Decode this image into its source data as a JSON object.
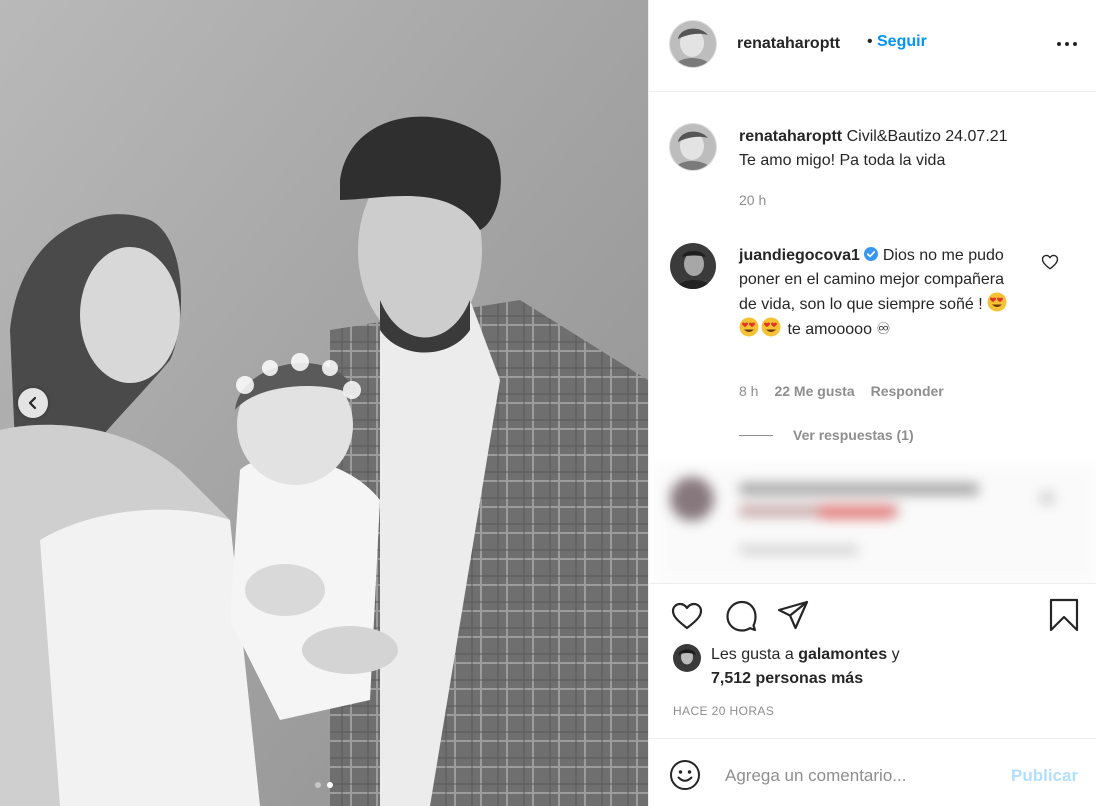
{
  "post": {
    "author": "renataharoptt",
    "separator": "•",
    "follow_label": "Seguir",
    "carousel_slides": 2,
    "carousel_active": 2
  },
  "caption": {
    "username": "renataharoptt",
    "text_line1": "Civil&Bautizo 24.07.21",
    "text_line2": "Te amo migo! Pa toda la vida",
    "time": "20 h"
  },
  "comment": {
    "username": "juandiegocova1",
    "verified": true,
    "text_part1": "Dios no me pudo poner en el camino mejor compañera de vida, son lo que siempre soñé !",
    "text_part2": "te amooooo ♾",
    "emoji": "heart-eyes-emoji",
    "emoji_count": 3,
    "time": "8 h",
    "likes": "22 Me gusta",
    "reply_label": "Responder",
    "view_replies": "Ver respuestas (1)"
  },
  "likes": {
    "prefix": "Les gusta a",
    "user": "galamontes",
    "conj": "y",
    "others": "7,512 personas más"
  },
  "post_time": "HACE 20 HORAS",
  "add_comment": {
    "placeholder": "Agrega un comentario...",
    "publish_label": "Publicar"
  },
  "icons": {
    "like": "heart-icon",
    "comment": "comment-bubble-icon",
    "share": "paper-plane-icon",
    "save": "bookmark-icon",
    "more": "more-options-icon",
    "emoji": "smiley-icon",
    "verified": "verified-badge-icon",
    "prev": "chevron-left-icon"
  },
  "colors": {
    "link": "#0095f6",
    "verified": "#3897f0",
    "publish_disabled": "#b2dffc",
    "muted": "#8e8e8e"
  }
}
